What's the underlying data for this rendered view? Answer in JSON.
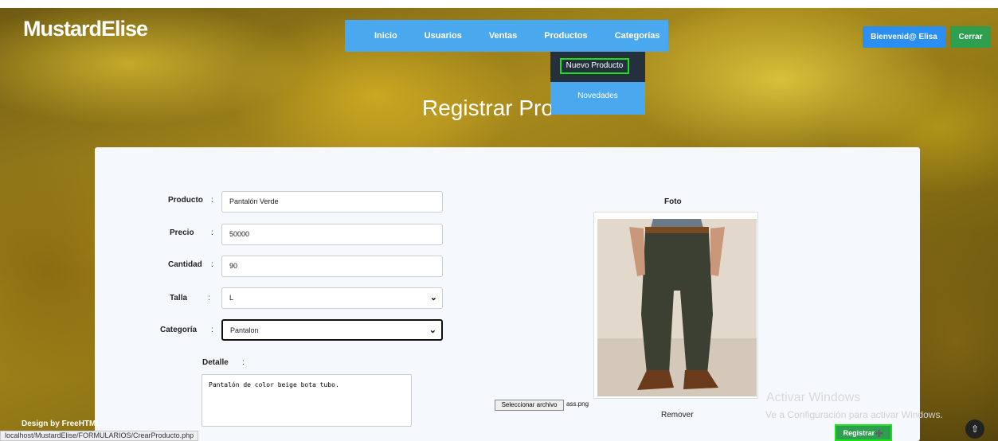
{
  "brand": "MustardElise",
  "nav": {
    "items": [
      "Inicio",
      "Usuarios",
      "Ventas",
      "Productos",
      "Categorías"
    ],
    "dropdown": [
      "Nuevo Producto",
      "Novedades"
    ]
  },
  "header": {
    "welcome": "Bienvenid@ Elisa",
    "logout": "Cerrar"
  },
  "page_title": "Registrar Producto",
  "form": {
    "product_label": "Producto",
    "product_value": "Pantalón Verde",
    "price_label": "Precio",
    "price_value": "50000",
    "quantity_label": "Cantidad",
    "quantity_value": "90",
    "size_label": "Talla",
    "size_value": "L",
    "category_label": "Categoría",
    "category_value": "Pantalon",
    "detail_label": "Detalle",
    "detail_value": "Pantalón de color beige bota tubo.",
    "colon": ":"
  },
  "photo": {
    "label": "Foto",
    "file_button": "Seleccionar archivo",
    "file_name": "ass.png",
    "remove": "Remover"
  },
  "register_button": "Registrar",
  "windows": {
    "title": "Activar Windows",
    "subtitle": "Ve a Configuración para activar Windows."
  },
  "footer_credit": "Design by FreeHTML",
  "status_url": "localhost/MustardElise/FORMULARIOS/CrearProducto.php",
  "colors": {
    "nav_bg": "#4aa8ee",
    "register_bg": "#2e9e4f",
    "highlight": "#19e219"
  }
}
